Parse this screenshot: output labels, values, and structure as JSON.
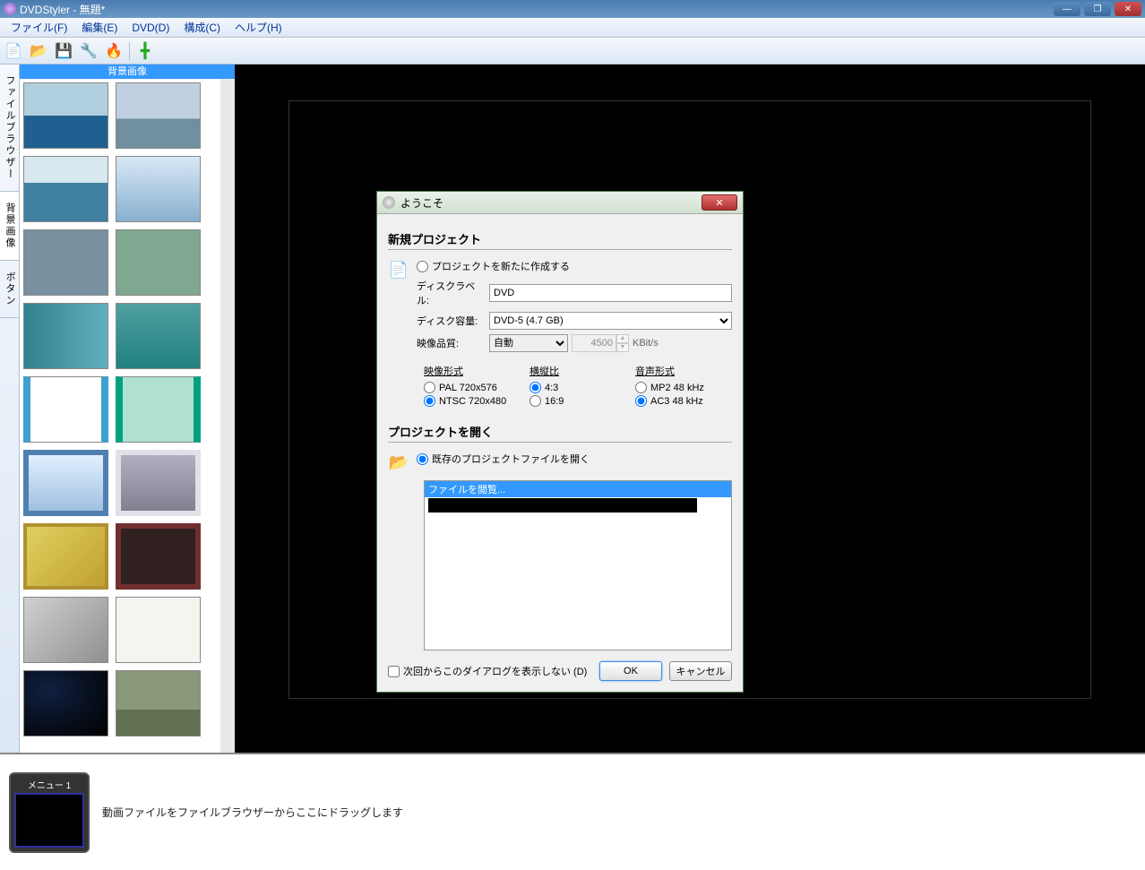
{
  "window": {
    "title": "DVDStyler - 無題*"
  },
  "menu": {
    "file": "ファイル(F)",
    "edit": "編集(E)",
    "dvd": "DVD(D)",
    "config": "構成(C)",
    "help": "ヘルプ(H)"
  },
  "sidetabs": {
    "filebrowser": "ファイルブラウザー",
    "backgrounds": "背景画像",
    "buttons": "ボタン"
  },
  "thumb_header": "背景画像",
  "timeline": {
    "menu1": "メニュー 1",
    "hint": "動画ファイルをファイルブラウザーからここにドラッグします"
  },
  "dialog": {
    "title": "ようこそ",
    "new_section": "新規プロジェクト",
    "radio_new": "プロジェクトを新たに作成する",
    "label_disclabel": "ディスクラベル:",
    "val_disclabel": "DVD",
    "label_capacity": "ディスク容量:",
    "val_capacity": "DVD-5 (4.7 GB)",
    "label_quality": "映像品質:",
    "val_quality": "自動",
    "bitrate": "4500",
    "bitrate_unit": "KBit/s",
    "grp_video": "映像形式",
    "video_pal": "PAL 720x576",
    "video_ntsc": "NTSC 720x480",
    "grp_aspect": "横縦比",
    "aspect_43": "4:3",
    "aspect_169": "16:9",
    "grp_audio": "音声形式",
    "audio_mp2": "MP2 48 kHz",
    "audio_ac3": "AC3 48 kHz",
    "open_section": "プロジェクトを開く",
    "radio_open": "既存のプロジェクトファイルを開く",
    "browse_row": "ファイルを閲覧...",
    "dont_show": "次回からこのダイアログを表示しない (D)",
    "ok": "OK",
    "cancel": "キャンセル"
  }
}
